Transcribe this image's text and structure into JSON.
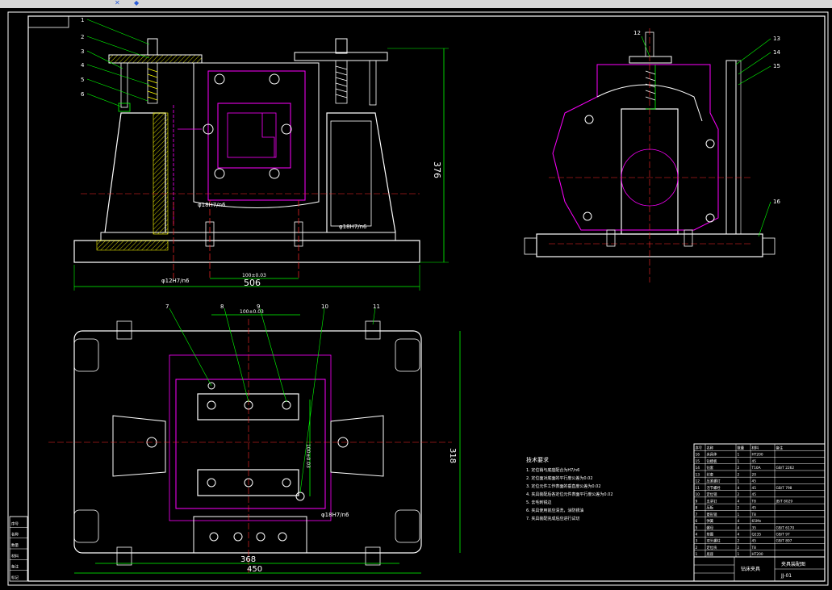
{
  "toolbar": {
    "icons": [
      "snap-icon",
      "layer-icon"
    ]
  },
  "colors": {
    "background": "#000000",
    "outline": "#ffffff",
    "hidden": "#ff00ff",
    "center": "#ff2a2a",
    "dimension": "#00ff00",
    "hatch": "#ffff00",
    "table": "#ffffff"
  },
  "front_view": {
    "height_dim": "376",
    "width_dim": "506",
    "fit_left": "φ12H7/n6",
    "fit_center": "φ18H7/n6",
    "fit_right": "φ18H7/n6",
    "center_dim": "100±0.03",
    "leaders": [
      "1",
      "2",
      "3",
      "4",
      "5",
      "6"
    ]
  },
  "side_view": {
    "leaders": [
      "12",
      "13",
      "14",
      "15",
      "16"
    ]
  },
  "top_view": {
    "height_dim": "318",
    "width_inner": "368",
    "width_outer": "450",
    "fit_bottom": "φ18H7/n6",
    "fit_vertical": "100±0.03",
    "top_dim": "100±0.03",
    "leaders": [
      "7",
      "8",
      "9",
      "10",
      "11"
    ]
  },
  "notes": {
    "title": "技术要求",
    "lines": [
      "1. 定位销与底座配合为H7/n6",
      "2. 定位面对底面的平行度公差为0.02",
      "3. 定位元件工作表面的垂直度公差为0.02",
      "4. 夹具装配后各定位元件表面平行度公差为0.02",
      "5. 去毛刺锐边",
      "6. 夹具使用前应清洗，涂防锈油",
      "7. 夹具装配完成后应进行试切"
    ]
  },
  "title_block": {
    "name": "钻床夹具",
    "company": "夹具装配图",
    "drawing_no": "JJ-01"
  },
  "bom": {
    "headers": [
      "序号",
      "名称",
      "数量",
      "材料",
      "备注"
    ],
    "rows": [
      [
        "16",
        "夹具体",
        "1",
        "HT200",
        ""
      ],
      [
        "15",
        "钻模板",
        "1",
        "45",
        ""
      ],
      [
        "14",
        "钻套",
        "2",
        "T10A",
        "GB/T 2262"
      ],
      [
        "13",
        "衬套",
        "2",
        "20",
        ""
      ],
      [
        "12",
        "压紧螺钉",
        "1",
        "45",
        ""
      ],
      [
        "11",
        "活节螺栓",
        "4",
        "45",
        "GB/T 798"
      ],
      [
        "10",
        "定位销",
        "2",
        "45",
        ""
      ],
      [
        "9",
        "支承钉",
        "4",
        "T8",
        "JB/T 8029"
      ],
      [
        "8",
        "压板",
        "2",
        "45",
        ""
      ],
      [
        "7",
        "菱形销",
        "1",
        "T8",
        ""
      ],
      [
        "6",
        "弹簧",
        "4",
        "65Mn",
        ""
      ],
      [
        "5",
        "螺母",
        "4",
        "35",
        "GB/T 6170"
      ],
      [
        "4",
        "垫圈",
        "4",
        "Q235",
        "GB/T 97"
      ],
      [
        "3",
        "双头螺柱",
        "2",
        "45",
        "GB/T 897"
      ],
      [
        "2",
        "定位块",
        "2",
        "T8",
        ""
      ],
      [
        "1",
        "底座",
        "1",
        "HT200",
        ""
      ]
    ]
  },
  "side_strip": [
    "序号",
    "名称",
    "数量",
    "材料",
    "备注",
    "标记"
  ]
}
